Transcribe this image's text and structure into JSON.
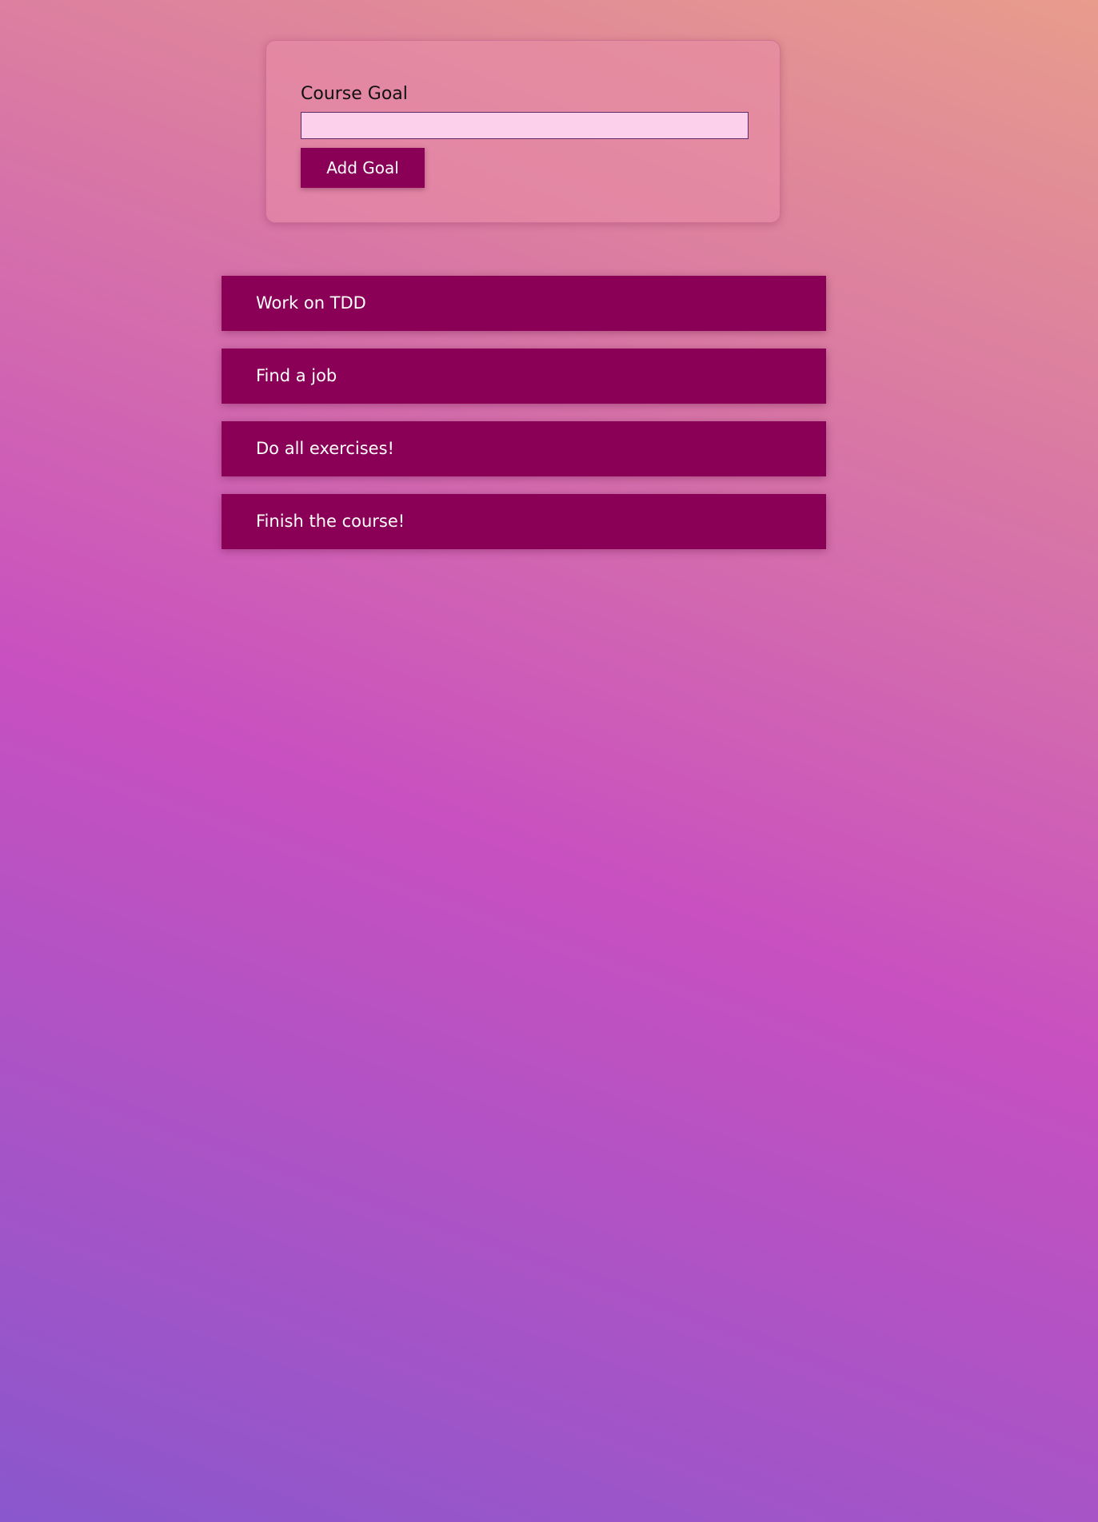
{
  "form": {
    "label": "Course Goal",
    "input_value": "",
    "input_placeholder": "",
    "button_label": "Add Goal"
  },
  "goals": [
    {
      "text": "Work on TDD"
    },
    {
      "text": "Find a job"
    },
    {
      "text": "Do all exercises!"
    },
    {
      "text": "Finish the course!"
    }
  ],
  "colors": {
    "primary": "#8a0057",
    "input_background": "#fccfea",
    "input_border": "#5e2a6a",
    "text_on_primary": "#ffffff"
  }
}
